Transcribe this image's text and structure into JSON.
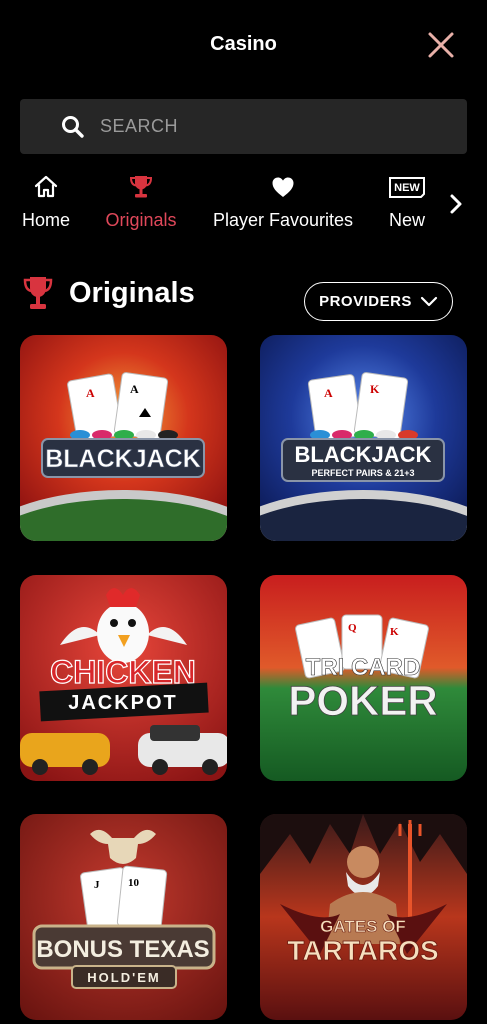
{
  "header": {
    "title": "Casino"
  },
  "search": {
    "placeholder": "SEARCH"
  },
  "categories": [
    {
      "label": "Home",
      "icon": "home-icon",
      "active": false
    },
    {
      "label": "Originals",
      "icon": "trophy-icon",
      "active": true
    },
    {
      "label": "Player Favourites",
      "icon": "heart-icon",
      "active": false
    },
    {
      "label": "New",
      "icon": "new-badge-icon",
      "badge": "NEW",
      "active": false
    }
  ],
  "section": {
    "title": "Originals",
    "providers_label": "PROVIDERS"
  },
  "games": [
    {
      "line1": "BLACKJACK",
      "line2": ""
    },
    {
      "line1": "BLACKJACK",
      "line2": "PERFECT PAIRS & 21+3"
    },
    {
      "line1": "CHICKEN",
      "line2": "JACKPOT"
    },
    {
      "line1": "TRI CARD",
      "line2": "POKER"
    },
    {
      "line1": "BONUS TEXAS",
      "line2": "HOLD'EM"
    },
    {
      "line1": "GATES OF",
      "line2": "TARTAROS"
    }
  ],
  "colors": {
    "accent": "#e0485a",
    "background": "#000000",
    "search_bg": "#262626"
  }
}
